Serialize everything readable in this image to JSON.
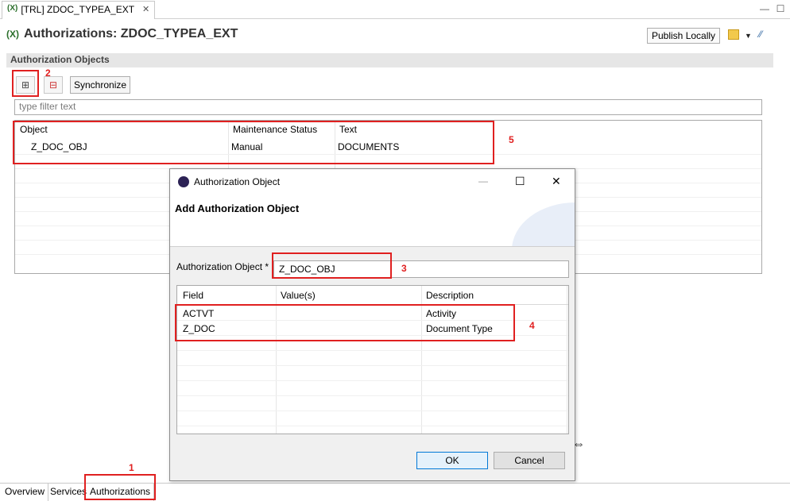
{
  "editor_tab": {
    "icon": "(X)",
    "label": "[TRL] ZDOC_TYPEA_EXT",
    "close": "✕"
  },
  "window_controls": {
    "minimize": "—",
    "maximize": "☐"
  },
  "page": {
    "icon": "(X)",
    "title": "Authorizations: ZDOC_TYPEA_EXT",
    "publish_label": "Publish Locally",
    "toolbar_glyph": "▼",
    "more_glyph": "⁄⁄"
  },
  "section": {
    "title": "Authorization Objects",
    "add_glyph": "⊞",
    "remove_glyph": "⊟",
    "sync_label": "Synchronize",
    "filter_placeholder": "type filter text"
  },
  "table": {
    "headers": [
      "Object",
      "Maintenance Status",
      "Text"
    ],
    "rows": [
      {
        "object": "Z_DOC_OBJ",
        "status": "Manual",
        "text": "DOCUMENTS"
      }
    ]
  },
  "bottom_tabs": [
    "Overview",
    "Services",
    "Authorizations"
  ],
  "dialog": {
    "title": "Authorization Object",
    "minimize": "—",
    "maximize": "☐",
    "close": "✕",
    "heading": "Add Authorization Object",
    "field_label": "Authorization Object *",
    "field_value": "Z_DOC_OBJ",
    "fields_headers": [
      "Field",
      "Value(s)",
      "Description"
    ],
    "fields_rows": [
      {
        "field": "ACTVT",
        "value": "",
        "description": "Activity"
      },
      {
        "field": "Z_DOC",
        "value": "",
        "description": "Document Type"
      }
    ],
    "ok_label": "OK",
    "cancel_label": "Cancel"
  },
  "cursor_glyph": "⇔",
  "annotations": [
    "1",
    "2",
    "3",
    "4",
    "5"
  ],
  "colors": {
    "annotation": "#e02020",
    "accent": "#2b6f2b"
  }
}
